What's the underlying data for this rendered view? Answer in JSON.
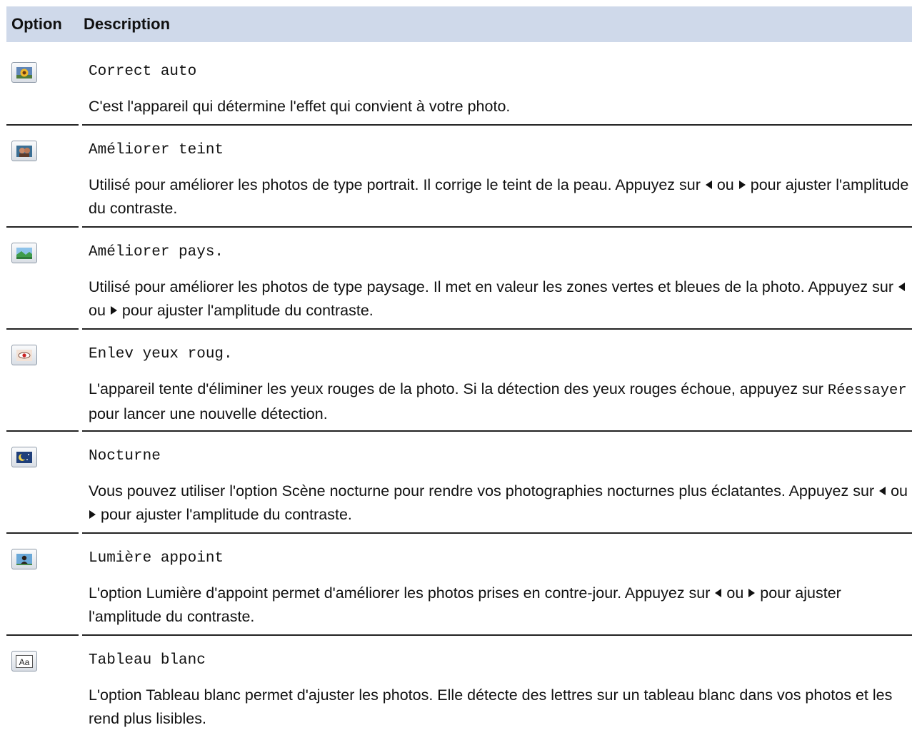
{
  "header": {
    "option": "Option",
    "description": "Description"
  },
  "rows": [
    {
      "icon": "sunflower-photo-icon",
      "name": "Correct auto",
      "desc_parts": [
        "C'est l'appareil qui détermine l'effet qui convient à votre photo."
      ]
    },
    {
      "icon": "portrait-photo-icon",
      "name": "Améliorer teint",
      "desc_parts": [
        "Utilisé pour améliorer les photos de type portrait. Il corrige le teint de la peau. Appuyez sur",
        "ou",
        "pour ajuster l'amplitude du contraste."
      ]
    },
    {
      "icon": "landscape-photo-icon",
      "name": "Améliorer pays.",
      "desc_parts": [
        "Utilisé pour améliorer les photos de type paysage. Il met en valeur les zones vertes et bleues de la photo. Appuyez sur",
        "ou",
        "pour ajuster l'amplitude du contraste."
      ]
    },
    {
      "icon": "red-eye-icon",
      "name": "Enlev yeux roug.",
      "desc_parts": [
        "L'appareil tente d'éliminer les yeux rouges de la photo. Si la détection des yeux rouges échoue, appuyez sur",
        "Réessayer",
        "pour lancer une nouvelle détection."
      ]
    },
    {
      "icon": "night-scene-icon",
      "name": "Nocturne",
      "desc_parts": [
        "Vous pouvez utiliser l'option Scène nocturne pour rendre vos photographies nocturnes plus éclatantes. Appuyez sur",
        "ou",
        "pour ajuster l'amplitude du contraste."
      ]
    },
    {
      "icon": "backlight-icon",
      "name": "Lumière appoint",
      "desc_parts": [
        "L'option Lumière d'appoint permet d'améliorer les photos prises en contre-jour. Appuyez sur",
        "ou",
        "pour ajuster l'amplitude du contraste."
      ]
    },
    {
      "icon": "whiteboard-text-icon",
      "name": "Tableau blanc",
      "desc_parts": [
        "L'option Tableau blanc permet d'ajuster les photos. Elle détecte des lettres sur un tableau blanc dans vos photos et les rend plus lisibles."
      ]
    }
  ]
}
